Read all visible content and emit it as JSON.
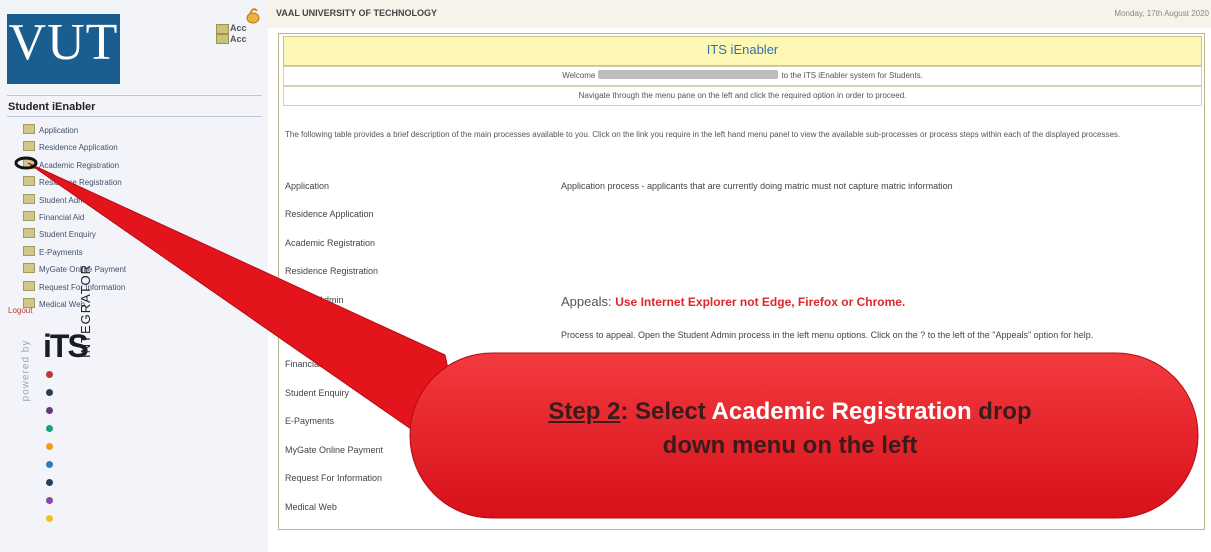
{
  "left_panel": {
    "logo_text": "VUT",
    "top_icons": [
      "Acc",
      "Acc"
    ],
    "title": "Student iEnabler",
    "menu": [
      "Application",
      "Residence Application",
      "Academic Registration",
      "Residence Registration",
      "Student Admin",
      "Financial Aid",
      "Student Enquiry",
      "E-Payments",
      "MyGate Online Payment",
      "Request For Information",
      "Medical Web"
    ],
    "logout": "Logout",
    "powered_by": "powered by",
    "its_logo_text": "iTS",
    "integrator_text": "INTEGRATOR"
  },
  "header": {
    "title": "VAAL UNIVERSITY OF TECHNOLOGY",
    "date": "Monday, 17th August 2020",
    "icon": "lamp-icon"
  },
  "main": {
    "heading": "ITS iEnabler",
    "welcome_prefix": "Welcome",
    "welcome_suffix": "to the ITS iEnabler system for Students.",
    "navigate_text": "Navigate through the menu pane on the left and click the required option in order to proceed.",
    "intro": "The following table provides a brief description of the main processes available to you. Click on the link you require in the left hand menu panel to view the available sub-processes or process steps within each of the displayed processes.",
    "processes": [
      "Application",
      "Residence Application",
      "Academic Registration",
      "Residence Registration",
      "Student Admin",
      "Financial Aid",
      "Student Enquiry",
      "E-Payments",
      "MyGate Online Payment",
      "Request For Information",
      "Medical Web"
    ],
    "application_desc": "Application process - applicants that are currently doing matric must not capture matric information",
    "appeals_label": "Appeals:",
    "appeals_warning": "Use Internet Explorer not Edge, Firefox or Chrome.",
    "appeal_process": "Process to appeal. Open the Student Admin process in the left menu options. Click on the ? to the left of the \"Appeals\" option for help."
  },
  "callout": {
    "step": "Step 2",
    "colon": ": Select ",
    "highlight": "Academic Registration",
    "rest_line1": " drop",
    "line2": "down menu on the left",
    "color": "#e3141c"
  }
}
